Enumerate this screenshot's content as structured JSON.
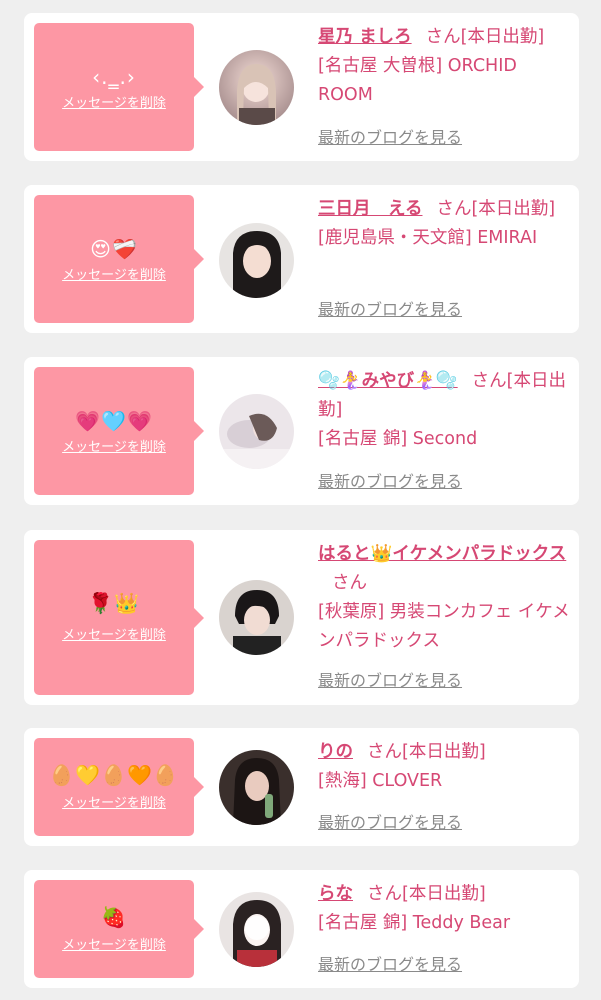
{
  "delete_label": "メッセージを削除",
  "san_label": "さん",
  "blog_label": "最新のブログを見る",
  "colors": {
    "bubble": "#fd97a4",
    "accent": "#d64874",
    "muted": "#8a8a8a"
  },
  "entries": [
    {
      "message": "‹.‗.›",
      "name": "星乃 ましろ",
      "status": "[本日出勤]",
      "shop": "[名古屋 大曽根] ORCHID ROOM"
    },
    {
      "message": "😍❤️‍🩹",
      "name": "三日月　える",
      "status": "[本日出勤]",
      "shop": "[鹿児島県・天文館] EMIRAI"
    },
    {
      "message": "💗🩵💗",
      "name": "🫧🧜‍♀️みやび🧜‍♀️🫧",
      "status": "[本日出勤]",
      "shop": "[名古屋 錦] Second"
    },
    {
      "message": "🌹👑",
      "name": "はると👑イケメンパラドックス",
      "status": "",
      "shop": "[秋葉原] 男装コンカフェ イケメンパラドックス"
    },
    {
      "message": "🥚💛🥚🧡🥚",
      "name": "りの",
      "status": "[本日出勤]",
      "shop": "[熱海] CLOVER"
    },
    {
      "message": "🍓",
      "name": "らな",
      "status": "[本日出勤]",
      "shop": "[名古屋 錦] Teddy Bear"
    }
  ]
}
